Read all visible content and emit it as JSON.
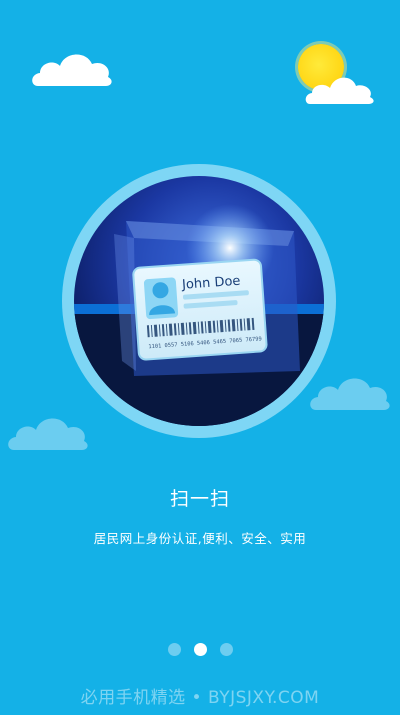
{
  "onboarding": {
    "card_name": "John Doe",
    "card_number": "1101 0557 5106 5406 5465 7065 76799",
    "title": "扫一扫",
    "subtitle": "居民网上身份认证,便利、安全、实用",
    "pagination": {
      "total": 3,
      "active_index": 1
    }
  },
  "watermark": "必用手机精选 • BYJSJXY.COM",
  "colors": {
    "background": "#14b1e7",
    "ring": "#7ed6f5",
    "sun": "#ffd614"
  }
}
